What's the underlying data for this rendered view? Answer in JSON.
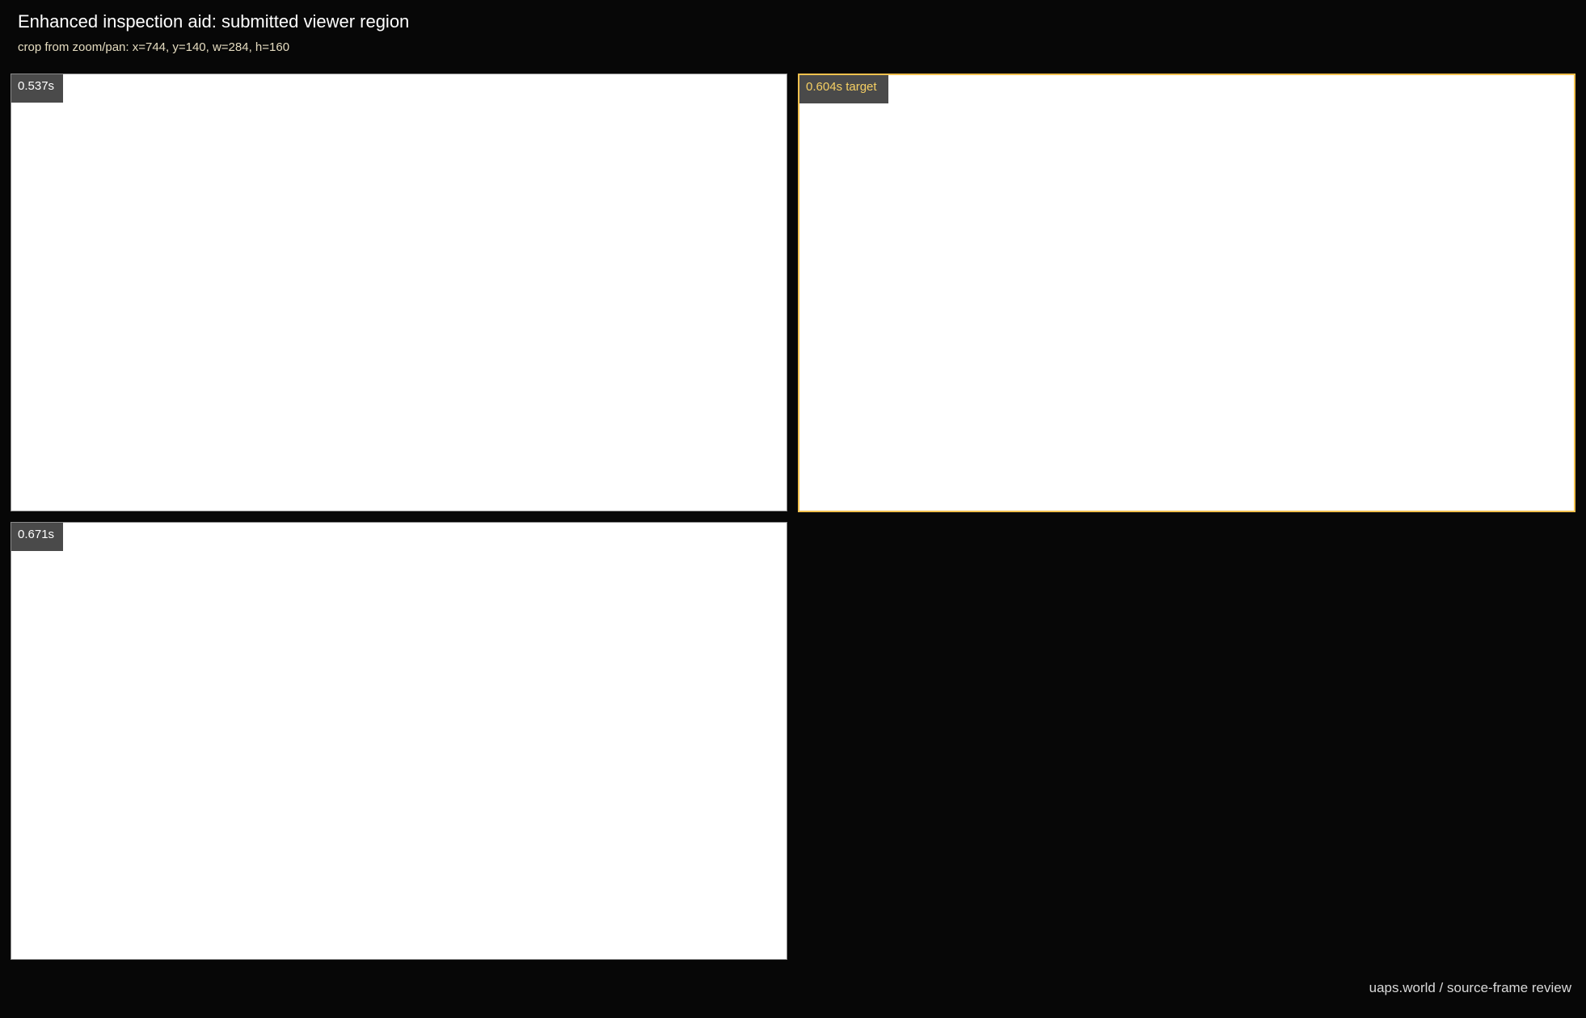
{
  "header": {
    "title": "Enhanced inspection aid: submitted viewer region",
    "subtitle": "crop from zoom/pan: x=744, y=140, w=284, h=160"
  },
  "frames": [
    {
      "label": "0.537s",
      "is_target": false
    },
    {
      "label": "0.604s target",
      "is_target": true
    },
    {
      "label": "0.671s",
      "is_target": false
    }
  ],
  "footer": {
    "text": "uaps.world / source-frame review"
  },
  "colors": {
    "background": "#070707",
    "target_accent": "#f2c14e",
    "label_background": "#4a4a4a"
  }
}
